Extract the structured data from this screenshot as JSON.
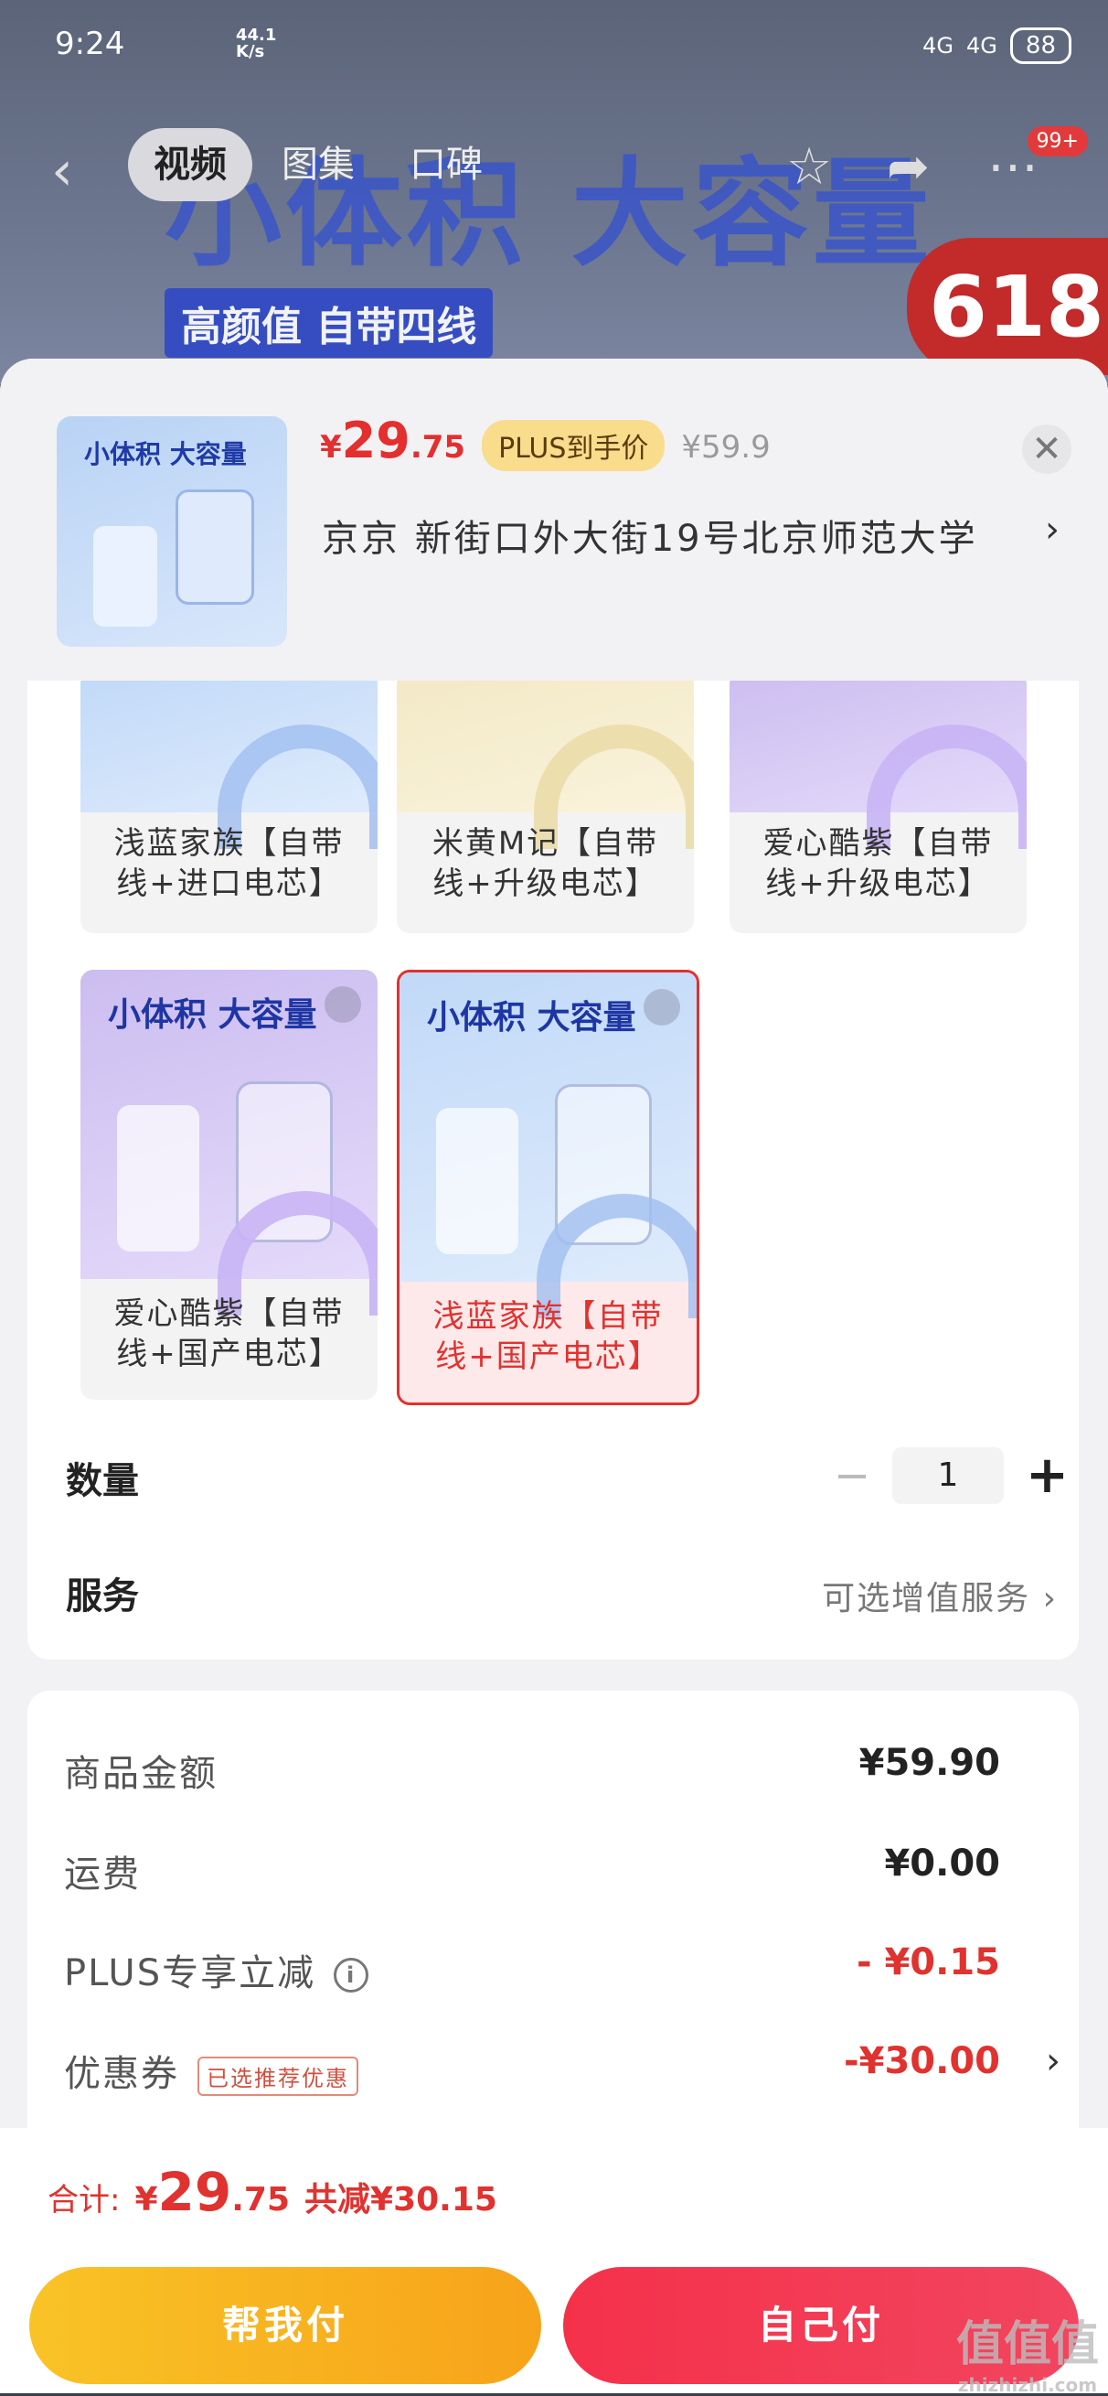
{
  "status_bar": {
    "time": "9:24",
    "speed_top": "44.1",
    "speed_bottom": "K/s",
    "net1": "4G",
    "net2": "4G",
    "battery": "88"
  },
  "banner": {
    "headline": "小体积  大容量",
    "subline": "高颜值 自带四线",
    "promo": "618"
  },
  "nav": {
    "tabs": [
      "视频",
      "图集",
      "口碑"
    ],
    "badge": "99+"
  },
  "product": {
    "thumb_headline": "小体积 大容量",
    "price_symbol": "¥",
    "price_int": "29",
    "price_dec": ".75",
    "plus_tag": "PLUS到手价",
    "original_price": "¥59.9",
    "address": "京京   新街口外大街19号北京师范大学"
  },
  "variants": [
    {
      "label": "浅蓝家族【自带线+进口电芯】",
      "theme": "blue"
    },
    {
      "label": "米黄M记【自带线+升级电芯】",
      "theme": "yellow"
    },
    {
      "label": "爱心酷紫【自带线+升级电芯】",
      "theme": "purple"
    },
    {
      "label": "爱心酷紫【自带线+国产电芯】",
      "theme": "purple",
      "headline": "小体积 大容量"
    },
    {
      "label": "浅蓝家族【自带线+国产电芯】",
      "theme": "blue",
      "headline": "小体积 大容量",
      "selected": true
    }
  ],
  "quantity": {
    "label": "数量",
    "value": "1",
    "minus": "−",
    "plus": "+"
  },
  "service": {
    "label": "服务",
    "value": "可选增值服务"
  },
  "summary": {
    "goods_label": "商品金额",
    "goods_value": "¥59.90",
    "shipping_label": "运费",
    "shipping_value": "¥0.00",
    "plus_label": "PLUS专享立减",
    "plus_value": "- ¥0.15",
    "coupon_label": "优惠券",
    "coupon_tag": "已选推荐优惠",
    "coupon_value": "-¥30.00"
  },
  "footer": {
    "total_label": "合计:",
    "total_symbol": "¥",
    "total_int": "29",
    "total_dec": ".75",
    "saved": "共减¥30.15",
    "help_pay": "帮我付",
    "self_pay": "自己付"
  },
  "watermark": {
    "main": "值值值",
    "sub": "zhizhizhi.com"
  },
  "colors": {
    "accent_red": "#e0322f",
    "help_btn": "#f7a31a",
    "self_btn": "#f2455f"
  }
}
